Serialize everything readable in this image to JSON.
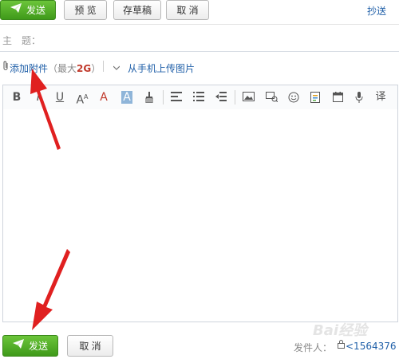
{
  "top_actions": {
    "send": "发送",
    "preview": "预 览",
    "save_draft": "存草稿",
    "cancel": "取 消",
    "cc": "抄送"
  },
  "subject": {
    "label": "主　题：",
    "value": ""
  },
  "attachment": {
    "add_label": "添加附件",
    "limit_prefix": "（最大",
    "limit_value": "2G",
    "limit_suffix": "）",
    "mobile_upload": "从手机上传图片"
  },
  "toolbar": {
    "bold": "B",
    "italic": "I",
    "underline": "U",
    "font_size": "A",
    "font_size_sup": "A",
    "font_color": "A",
    "highlight": "A",
    "translate": "译"
  },
  "editor": {
    "content": ""
  },
  "bottom_actions": {
    "send": "发送",
    "cancel": "取 消",
    "sender_label": "发件人：",
    "sender_value": "<1564376"
  },
  "watermark": "Bai经验",
  "colors": {
    "send_green": "#4aa824",
    "link_blue": "#1f5fa8",
    "annotation_red": "#e02020",
    "font_red": "#c0392b"
  }
}
